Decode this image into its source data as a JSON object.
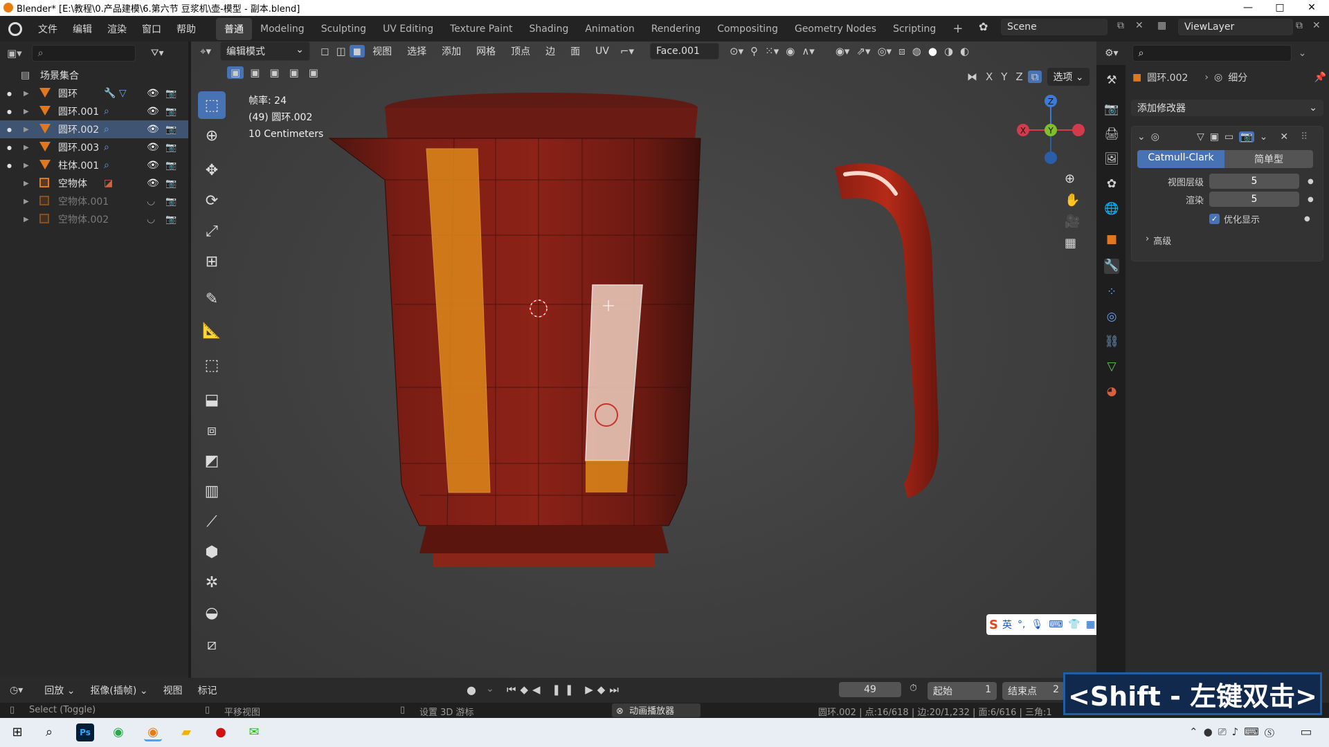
{
  "window": {
    "title": "Blender* [E:\\教程\\0.产品建模\\6.第六节 豆浆机\\壶-模型 - 副本.blend]",
    "controls": [
      "—",
      "□",
      "✕"
    ]
  },
  "topbar": {
    "menus": [
      "文件",
      "编辑",
      "渲染",
      "窗口",
      "帮助"
    ],
    "workspaces": [
      "普通",
      "Modeling",
      "Sculpting",
      "UV Editing",
      "Texture Paint",
      "Shading",
      "Animation",
      "Rendering",
      "Compositing",
      "Geometry Nodes",
      "Scripting"
    ],
    "active_workspace": "普通",
    "add_workspace": "+",
    "scene": "Scene",
    "view_layer": "ViewLayer"
  },
  "outliner": {
    "header": "场景集合",
    "items": [
      {
        "name": "圆环",
        "type": "mesh",
        "selected": false,
        "dim": false,
        "visible": true
      },
      {
        "name": "圆环.001",
        "type": "mesh",
        "selected": false,
        "dim": false,
        "visible": true
      },
      {
        "name": "圆环.002",
        "type": "mesh",
        "selected": true,
        "dim": false,
        "visible": true
      },
      {
        "name": "圆环.003",
        "type": "mesh",
        "selected": false,
        "dim": false,
        "visible": true
      },
      {
        "name": "柱体.001",
        "type": "mesh",
        "selected": false,
        "dim": false,
        "visible": true
      },
      {
        "name": "空物体",
        "type": "empty",
        "selected": false,
        "dim": false,
        "visible": true
      },
      {
        "name": "空物体.001",
        "type": "empty",
        "selected": false,
        "dim": true,
        "visible": false
      },
      {
        "name": "空物体.002",
        "type": "empty",
        "selected": false,
        "dim": true,
        "visible": false
      }
    ]
  },
  "viewport_header": {
    "mode": "编辑模式",
    "menus": [
      "视图",
      "选择",
      "添加",
      "网格",
      "顶点",
      "边",
      "面",
      "UV"
    ],
    "active_face": "Face.001",
    "axes": [
      "X",
      "Y",
      "Z"
    ],
    "options": "选项"
  },
  "viewport_overlay": {
    "fps": "帧率: 24",
    "object": "(49) 圆环.002",
    "unit": "10 Centimeters"
  },
  "gizmo": {
    "x": "X",
    "y": "Y",
    "z": "Z"
  },
  "properties": {
    "object": "圆环.002",
    "modifier_name": "细分",
    "add_modifier": "添加修改器",
    "tabs": [
      "Catmull-Clark",
      "简单型"
    ],
    "active_tab": "Catmull-Clark",
    "levels_label": "视图层级",
    "levels_value": "5",
    "render_label": "渲染",
    "render_value": "5",
    "optimal_label": "优化显示",
    "optimal_checked": true,
    "advanced": "高级"
  },
  "timeline": {
    "playback": "回放",
    "keying": "抠像(插帧)",
    "view": "视图",
    "marker": "标记",
    "current_frame": "49",
    "start_label": "起始",
    "start_value": "1",
    "end_label": "结束点",
    "end_value": "2"
  },
  "statusbar": {
    "left": "Select (Toggle)",
    "mid": "平移视图",
    "cursor": "设置 3D 游标",
    "anim": "动画播放器",
    "stats": "圆环.002 | 点:16/618 | 边:20/1,232 | 面:6/616 | 三角:1"
  },
  "ime": {
    "label": "英"
  },
  "shortcut_overlay": "<Shift - 左键双击>",
  "colors": {
    "accent": "#4772b3",
    "selected_row": "#3e5472",
    "mesh_icon": "#e0781e",
    "face_select": "#e38f1a",
    "body": "#8a2018"
  }
}
